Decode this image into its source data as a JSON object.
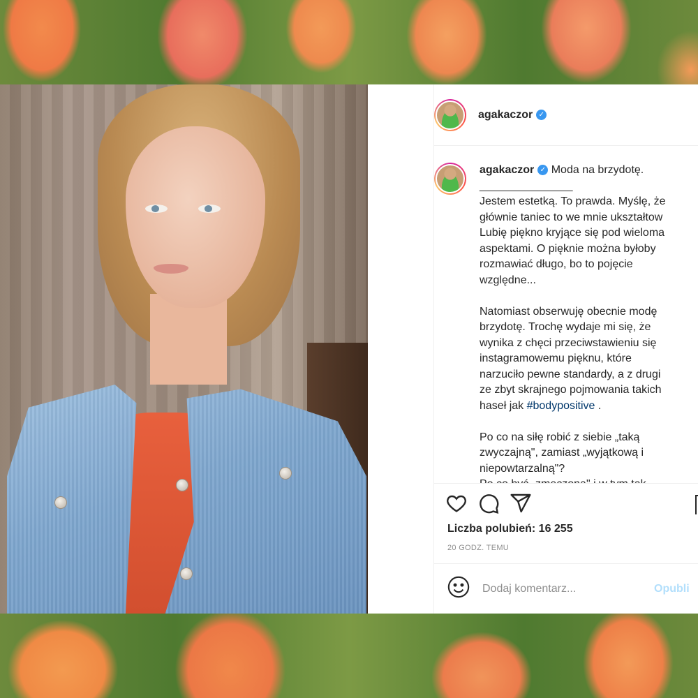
{
  "post": {
    "username": "agakaczor",
    "verified": true,
    "caption": {
      "first_line": "Moda na brzydotę.",
      "divider": "_______________",
      "lines": [
        "Jestem estetką. To prawda. Myślę, że",
        "głównie taniec to we mnie ukształtow",
        "Lubię piękno kryjące się pod wieloma",
        "aspektami. O pięknie można byłoby",
        "rozmawiać długo, bo to pojęcie",
        "względne...",
        "",
        "Natomiast obserwuję obecnie modę",
        "brzydotę. Trochę wydaje mi się, że",
        "wynika z chęci przeciwstawieniu się",
        "instagramowemu pięknu, które",
        "narzuciło pewne standardy, a z drugi",
        "ze zbyt skrajnego pojmowania takich",
        "haseł jak",
        "",
        "Po co na siłę robić z siebie „taką",
        "zwyczajną\", zamiast „wyjątkową i",
        "niepowtarzalną\"?",
        "Po co być „zmęczona\" i w tym tak"
      ],
      "hashtag": "#bodypositive",
      "hashtag_suffix": " ."
    },
    "likes_text": "Liczba polubień: 16 255",
    "time_ago": "20 GODZ. TEMU",
    "comment_placeholder": "Dodaj komentarz...",
    "publish_label": "Opubli"
  },
  "icons": {
    "like": "heart-icon",
    "comment": "comment-icon",
    "share": "share-icon",
    "emoji": "smile-icon",
    "verified": "verified-badge-icon"
  },
  "colors": {
    "text": "#262626",
    "secondary": "#8e8e8e",
    "link": "#00376b",
    "publish_disabled": "#b2dffc",
    "verified": "#3897f0"
  }
}
